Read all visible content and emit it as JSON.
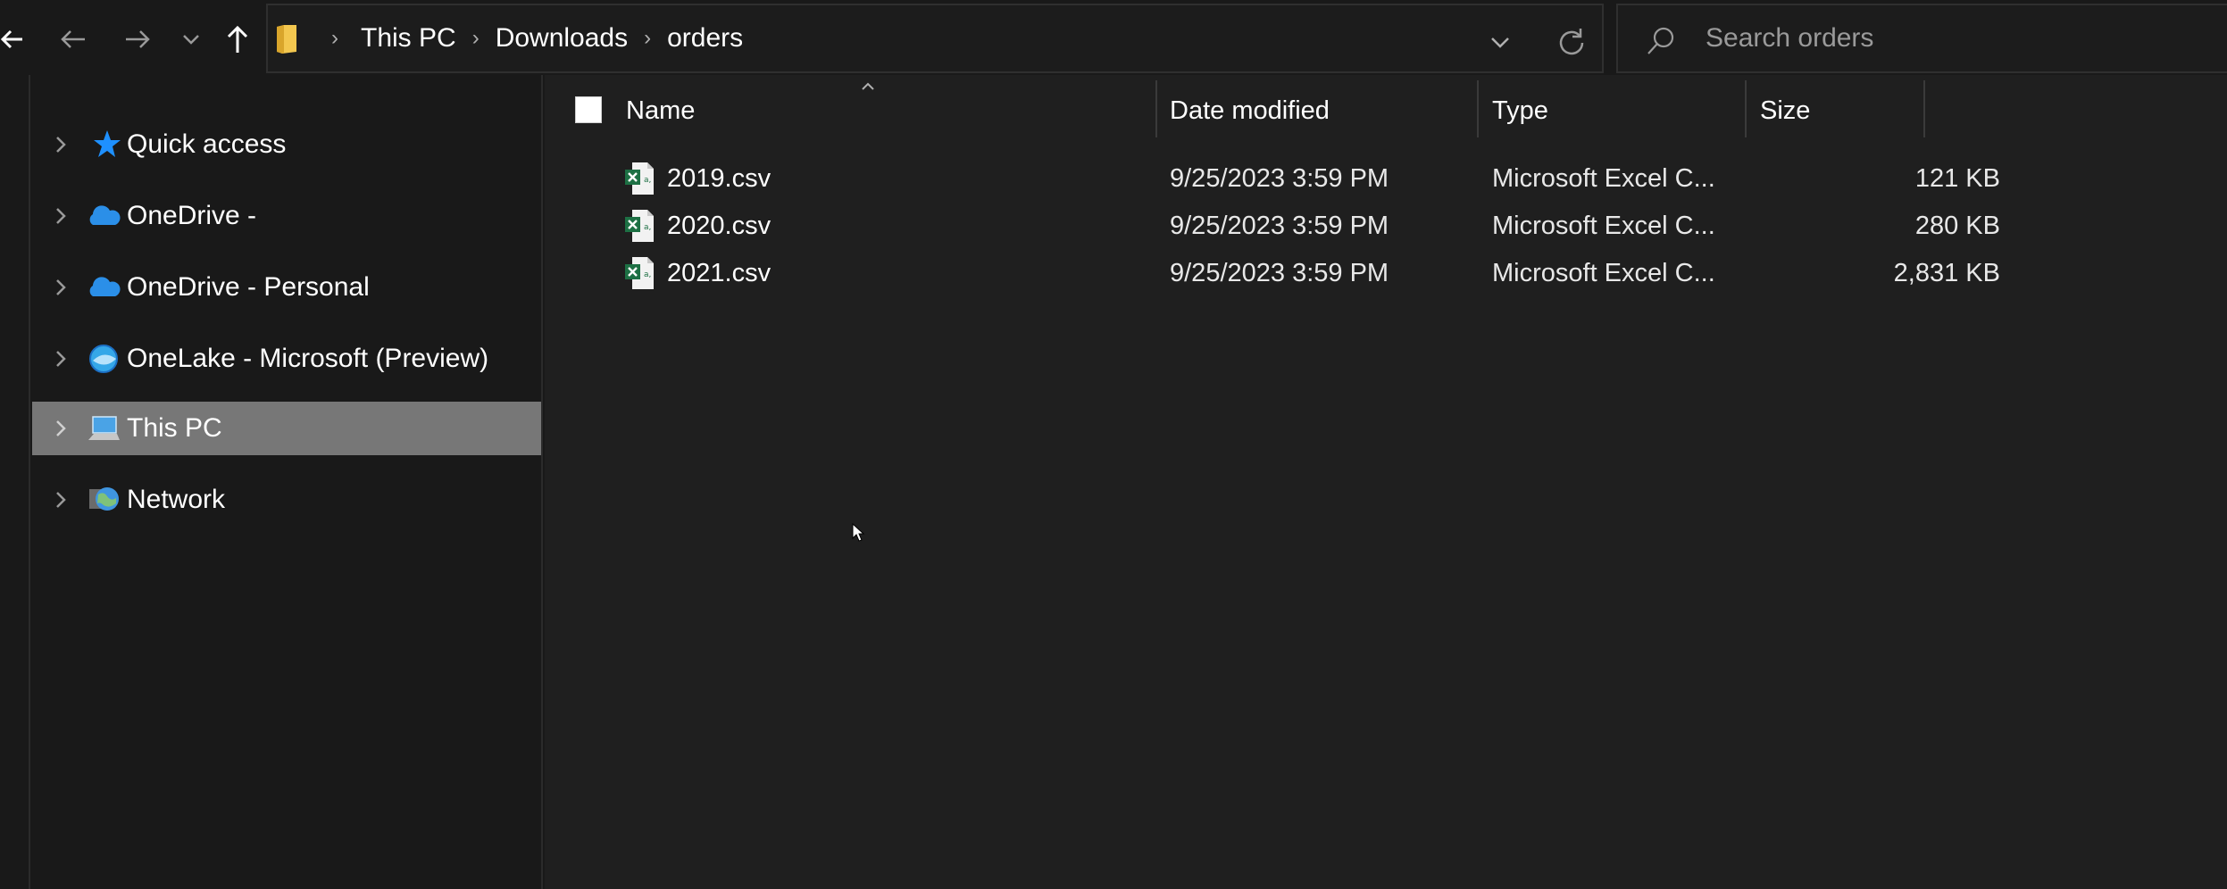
{
  "toolbar": {
    "back_label": "Back",
    "forward_label": "Forward",
    "recent_label": "Recent locations",
    "up_label": "Up"
  },
  "address": {
    "breadcrumbs": [
      "This PC",
      "Downloads",
      "orders"
    ]
  },
  "search": {
    "placeholder": "Search orders"
  },
  "sidebar": {
    "items": [
      {
        "label": "Quick access",
        "icon": "star-icon",
        "color": "#1e90ff"
      },
      {
        "label": "OneDrive -",
        "icon": "cloud-icon",
        "color": "#2b8fe8"
      },
      {
        "label": "OneDrive - Personal",
        "icon": "cloud-icon",
        "color": "#2b8fe8"
      },
      {
        "label": "OneLake - Microsoft (Preview)",
        "icon": "onelake-icon",
        "color": "#35a7e8"
      },
      {
        "label": "This PC",
        "icon": "computer-icon",
        "selected": true
      },
      {
        "label": "Network",
        "icon": "network-icon"
      }
    ],
    "selected_bg": "#777777"
  },
  "filelist": {
    "columns": [
      "Name",
      "Date modified",
      "Type",
      "Size"
    ],
    "sort_column": "Name",
    "rows": [
      {
        "name": "2019.csv",
        "date": "9/25/2023 3:59 PM",
        "type": "Microsoft Excel C...",
        "size": "121 KB"
      },
      {
        "name": "2020.csv",
        "date": "9/25/2023 3:59 PM",
        "type": "Microsoft Excel C...",
        "size": "280 KB"
      },
      {
        "name": "2021.csv",
        "date": "9/25/2023 3:59 PM",
        "type": "Microsoft Excel C...",
        "size": "2,831 KB"
      }
    ]
  },
  "colors": {
    "background": "#191919",
    "list_background": "#1f1f1f",
    "excel_green": "#1d7044"
  }
}
